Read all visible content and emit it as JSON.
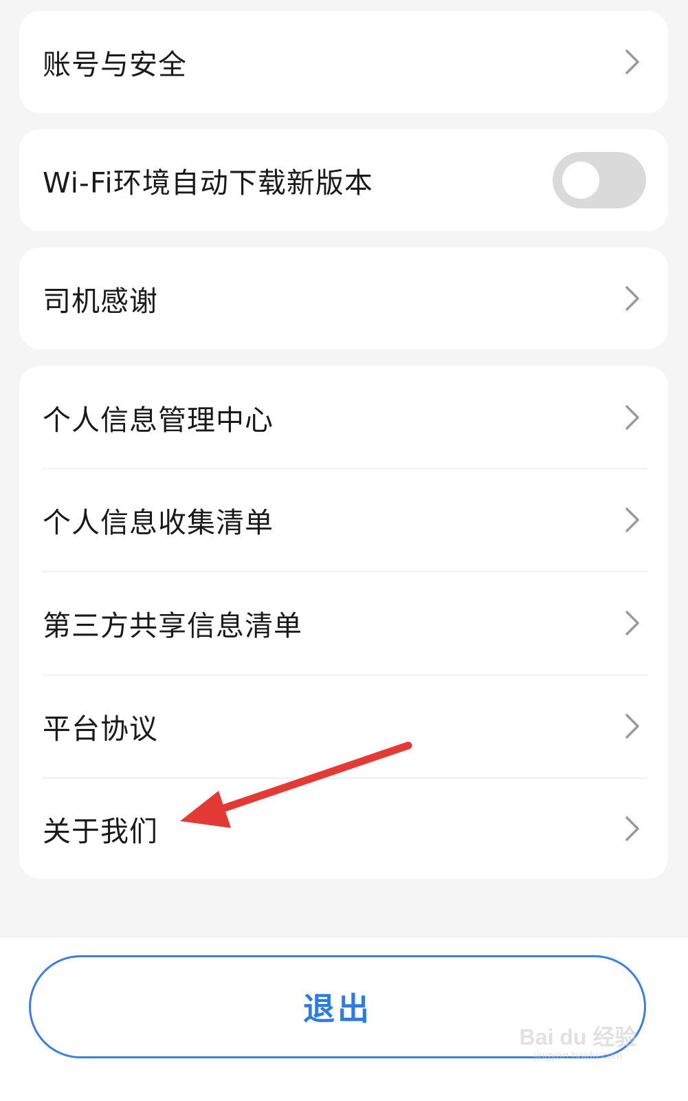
{
  "settings": {
    "account_security": "账号与安全",
    "wifi_auto_update": "Wi-Fi环境自动下载新版本",
    "wifi_auto_update_enabled": false,
    "driver_thanks": "司机感谢",
    "privacy_items": [
      "个人信息管理中心",
      "个人信息收集清单",
      "第三方共享信息清单",
      "平台协议",
      "关于我们"
    ]
  },
  "footer": {
    "logout_label": "退出"
  },
  "watermark": {
    "main": "Bai du 经验",
    "sub": "jingyan.baidu.com"
  },
  "colors": {
    "accent": "#2f7be0",
    "annotation": "#e53935",
    "background": "#f5f5f5",
    "card": "#ffffff"
  },
  "icons": {
    "row_chevron": "chevron-right-icon"
  }
}
